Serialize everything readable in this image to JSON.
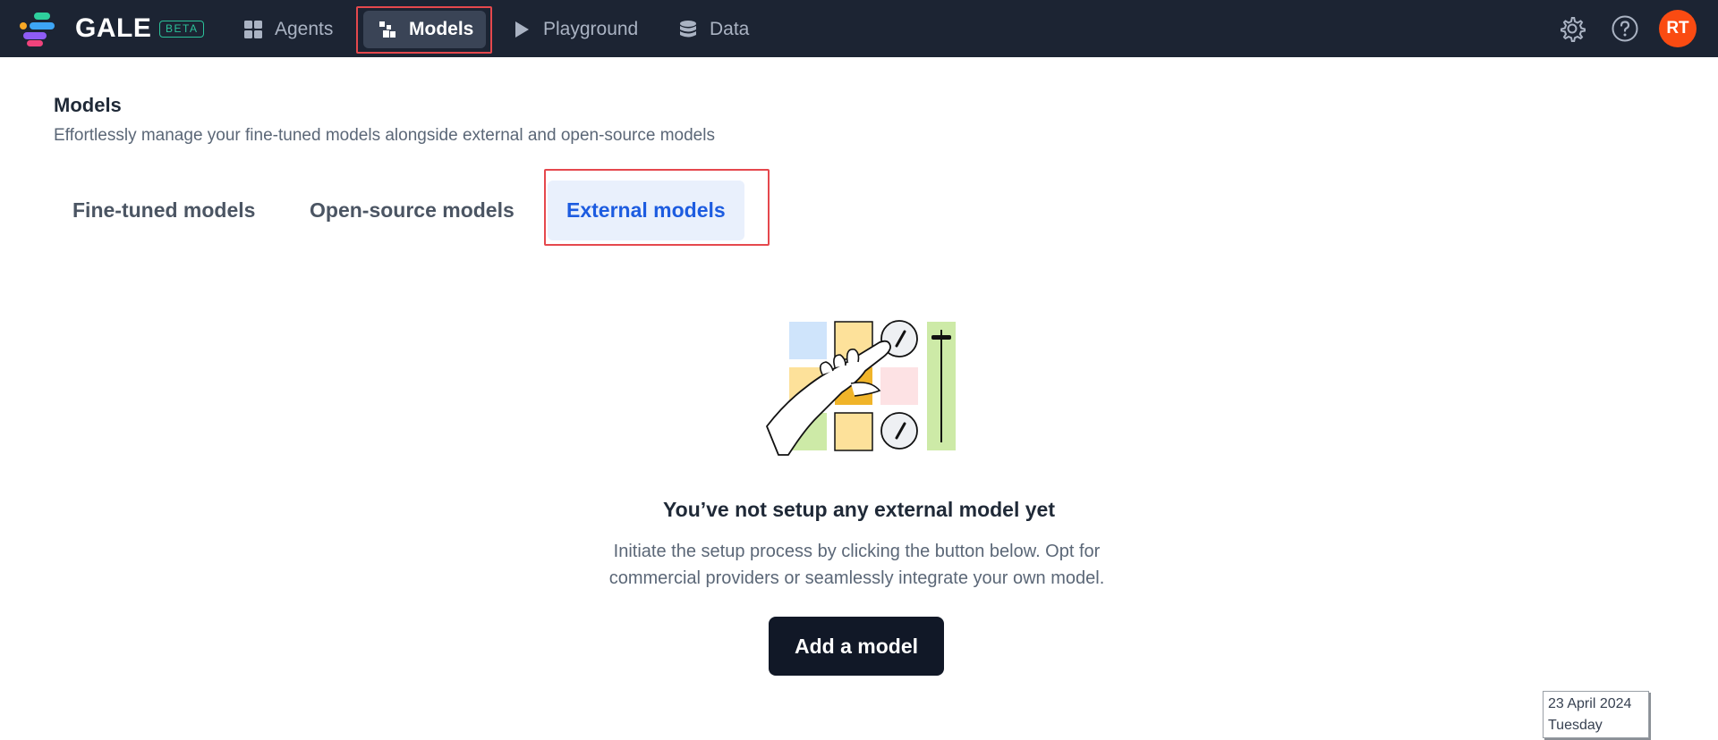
{
  "app": {
    "brand": "GALE",
    "beta_badge": "BETA",
    "user_initials": "RT"
  },
  "nav": {
    "items": [
      {
        "label": "Agents",
        "icon": "grid-icon"
      },
      {
        "label": "Models",
        "icon": "models-icon",
        "active": true
      },
      {
        "label": "Playground",
        "icon": "play-icon"
      },
      {
        "label": "Data",
        "icon": "database-icon"
      }
    ],
    "right_icons": [
      "gear-icon",
      "help-icon"
    ]
  },
  "page": {
    "title": "Models",
    "subtitle": "Effortlessly manage your fine-tuned models alongside external and open-source models"
  },
  "tabs": [
    {
      "label": "Fine-tuned models"
    },
    {
      "label": "Open-source models"
    },
    {
      "label": "External models",
      "active": true
    }
  ],
  "empty_state": {
    "title": "You’ve not setup any external model yet",
    "description": "Initiate the setup process by clicking the button below. Opt for commercial providers or seamlessly integrate your own model.",
    "button_label": "Add a model"
  },
  "date_stamp": {
    "date": "23 April 2024",
    "day": "Tuesday"
  },
  "colors": {
    "topbar": "#1c2433",
    "active_nav": "#3a4456",
    "highlight": "#e5484d",
    "active_tab_bg": "#e9f0fc",
    "active_tab_text": "#1d5ce0",
    "avatar": "#fa4b12",
    "primary_button": "#111827"
  }
}
